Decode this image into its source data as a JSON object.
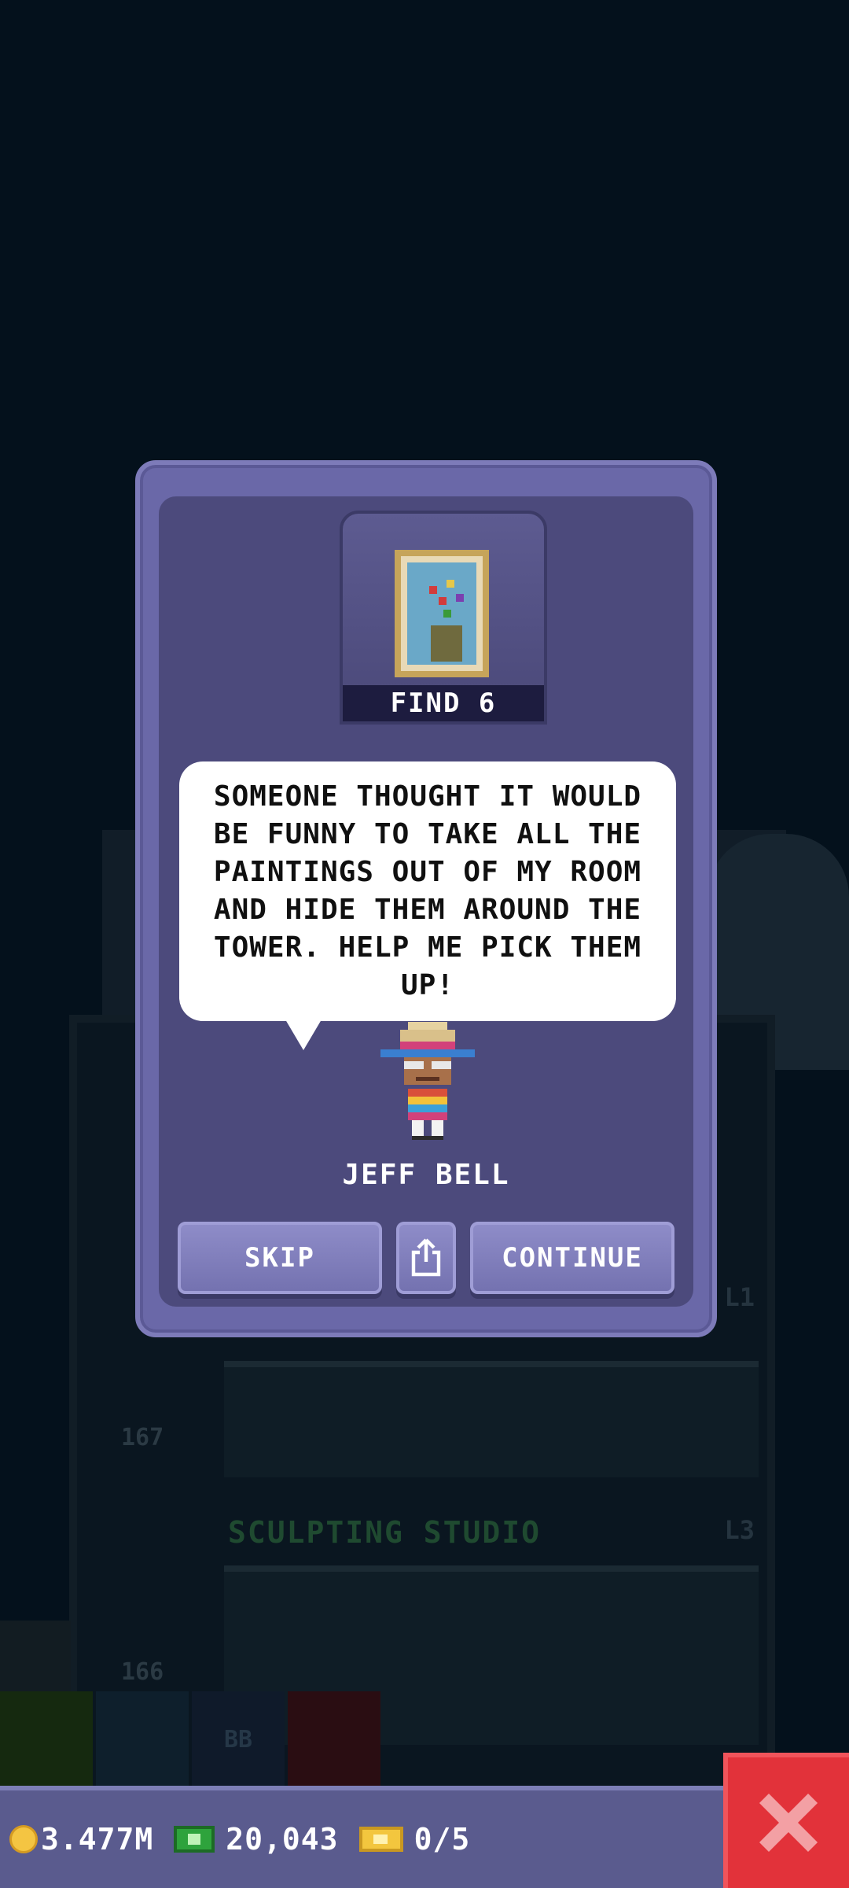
{
  "background": {
    "floor_numbers": [
      "167",
      "166"
    ],
    "floor_room_name": "SCULPTING STUDIO",
    "floor_level": "L3",
    "upper_level": "L1",
    "bottom_button_label": "BB"
  },
  "quest": {
    "find_label": "FIND 6",
    "message": "SOMEONE THOUGHT IT WOULD BE FUNNY TO TAKE ALL THE PAINTINGS OUT OF MY ROOM AND HIDE THEM AROUND THE TOWER. HELP ME PICK THEM UP!",
    "npc_name": "JEFF BELL",
    "skip_label": "SKIP",
    "share_icon": "share-icon",
    "continue_label": "CONTINUE"
  },
  "status": {
    "coins": "3.477M",
    "bux": "20,043",
    "tickets": "0/5",
    "close_icon": "close-icon"
  },
  "colors": {
    "dialog": "#6a68a8",
    "close_button": "#e2323a",
    "status_bar": "#5a5b8e"
  }
}
